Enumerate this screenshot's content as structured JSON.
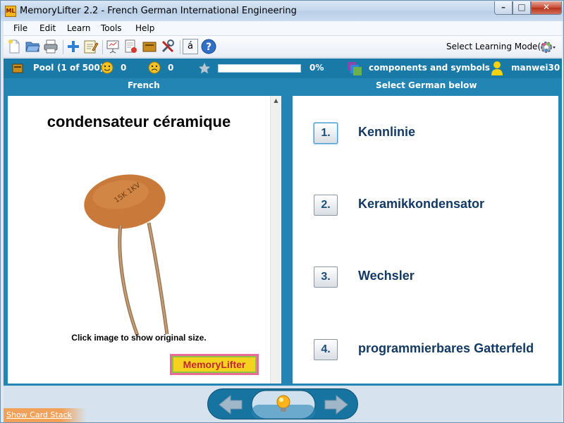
{
  "window": {
    "title": "MemoryLifter 2.2 - French German International Engineering",
    "app_icon": "ML"
  },
  "menu": [
    "File",
    "Edit",
    "Learn",
    "Tools",
    "Help"
  ],
  "toolbar": {
    "icons": [
      "new-file-icon",
      "open-folder-icon",
      "print-icon",
      "add-icon",
      "edit-notepad-icon",
      "presentation-icon",
      "card-chart-icon",
      "box-icon",
      "tools-icon",
      "special-character-icon",
      "help-icon"
    ],
    "mode_label": "Select Learning Mode(s)",
    "special_char": "á"
  },
  "status": {
    "pool_label": "Pool",
    "pool_count": "(1 of 500)",
    "happy_count": "0",
    "sad_count": "0",
    "progress_text": "0%",
    "progress_fraction": 0.0,
    "chapter": "components and symbols",
    "user": "manwei30"
  },
  "columns": {
    "question_language": "French",
    "answer_instruction": "Select German below"
  },
  "question": {
    "word": "condensateur céramique",
    "image_hint": "Click image to show original size.",
    "logo_text_a": "Memory",
    "logo_text_b": "Lifter"
  },
  "answers": [
    {
      "number": "1.",
      "text": "Kennlinie",
      "selected": true
    },
    {
      "number": "2.",
      "text": "Keramikkondensator",
      "selected": false
    },
    {
      "number": "3.",
      "text": "Wechsler",
      "selected": false
    },
    {
      "number": "4.",
      "text": "programmierbares Gatterfeld",
      "selected": false
    }
  ],
  "footer": {
    "show_card_stack": "Show Card Stack"
  },
  "colors": {
    "accent": "#2385b4",
    "status_bar": "#1a7aa7",
    "answer_text": "#123a64"
  }
}
